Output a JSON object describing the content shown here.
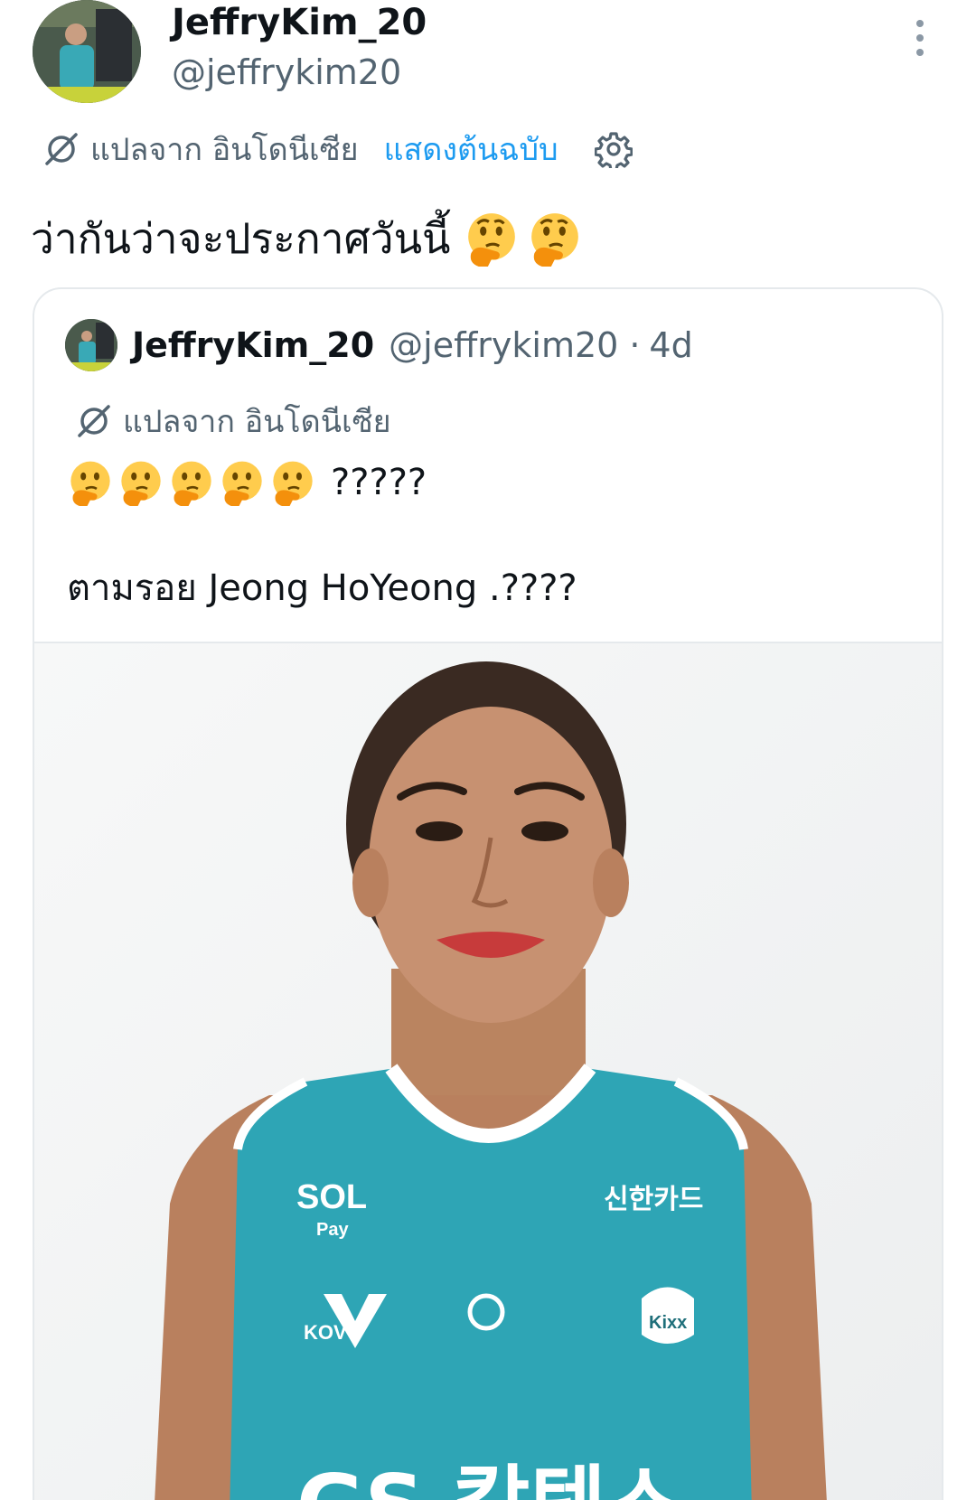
{
  "author": {
    "display_name": "JeffryKim_20",
    "handle": "@jeffrykim20"
  },
  "translation": {
    "label": "แปลจาก อินโดนีเซีย",
    "show_original": "แสดงต้นฉบับ"
  },
  "tweet": {
    "text": "ว่ากันว่าจะประกาศวันนี้",
    "emoji_count": 2
  },
  "quoted": {
    "display_name": "JeffryKim_20",
    "handle": "@jeffrykim20",
    "separator": "·",
    "time": "4d",
    "translation_label": "แปลจาก อินโดนีเซีย",
    "line1_text": "?????",
    "line2_text": "ตามรอย Jeong HoYeong .????"
  },
  "photo": {
    "jersey_sponsor": "신한카드",
    "jersey_brand": "SOL",
    "jersey_brand_sub": "Pay",
    "league_logo": "KOVO",
    "team_badge": "Kixx",
    "chest_text": "GS 칼텍스"
  },
  "colors": {
    "link": "#1d9bf0",
    "muted": "#536471",
    "jersey": "#2ea5b5"
  },
  "icons": [
    "translate-icon",
    "gear-icon",
    "more-options-icon",
    "thinking-face-emoji"
  ]
}
